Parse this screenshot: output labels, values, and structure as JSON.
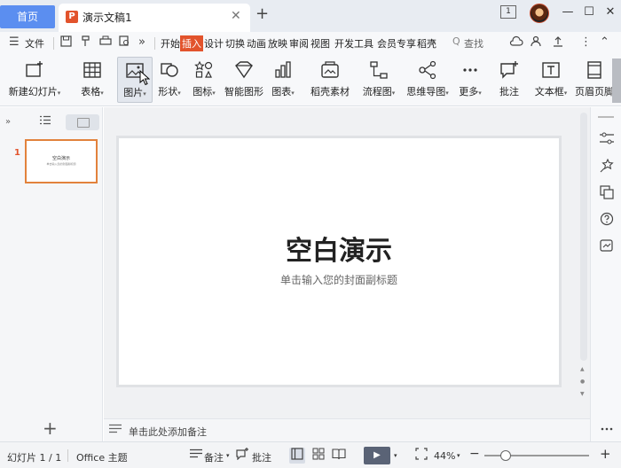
{
  "titlebar": {
    "home_tab": "首页",
    "doc_icon_letter": "P",
    "doc_title": "演示文稿1",
    "close_glyph": "✕",
    "new_tab_glyph": "+",
    "window_count": "1",
    "minimize_glyph": "—",
    "maximize_glyph": "☐",
    "close_window_glyph": "✕"
  },
  "menubar": {
    "menu_glyph": "☰",
    "file_label": "文件",
    "more_glyph": "»",
    "tabs": [
      "开始",
      "插入",
      "设计",
      "切换",
      "动画",
      "放映",
      "审阅",
      "视图",
      "开发工具",
      "会员专享",
      "稻壳"
    ],
    "active_tab": "插入",
    "next_glyph": "›",
    "search_glyph": "Q",
    "search_label": "查找",
    "overflow_glyph": "⋮",
    "collapse_glyph": "⌃"
  },
  "ribbon": {
    "new_slide": "新建幻灯片",
    "table": "表格",
    "picture": "图片",
    "shape": "形状",
    "icon": "图标",
    "smart_graphic": "智能图形",
    "chart": "图表",
    "docer_material": "稻壳素材",
    "flowchart": "流程图",
    "mindmap": "思维导图",
    "more": "更多",
    "comment": "批注",
    "textbox": "文本框",
    "header_footer": "页眉页脚",
    "caret": "▾"
  },
  "leftpanel": {
    "expand_glyph": "»",
    "slide_number": "1",
    "thumb_title": "空白演示",
    "thumb_subtitle": "单击输入您的封面副标题",
    "add_glyph": "+"
  },
  "slide": {
    "title": "空白演示",
    "subtitle": "单击输入您的封面副标题"
  },
  "notes": {
    "placeholder": "单击此处添加备注"
  },
  "statusbar": {
    "slide_indicator": "幻灯片 1 / 1",
    "theme": "Office 主题",
    "notes_label": "备注",
    "comment_label": "批注",
    "zoom_level": "44%",
    "zoom_caret": "▾",
    "zoom_minus": "−",
    "zoom_plus": "+",
    "play_glyph": "▶"
  }
}
